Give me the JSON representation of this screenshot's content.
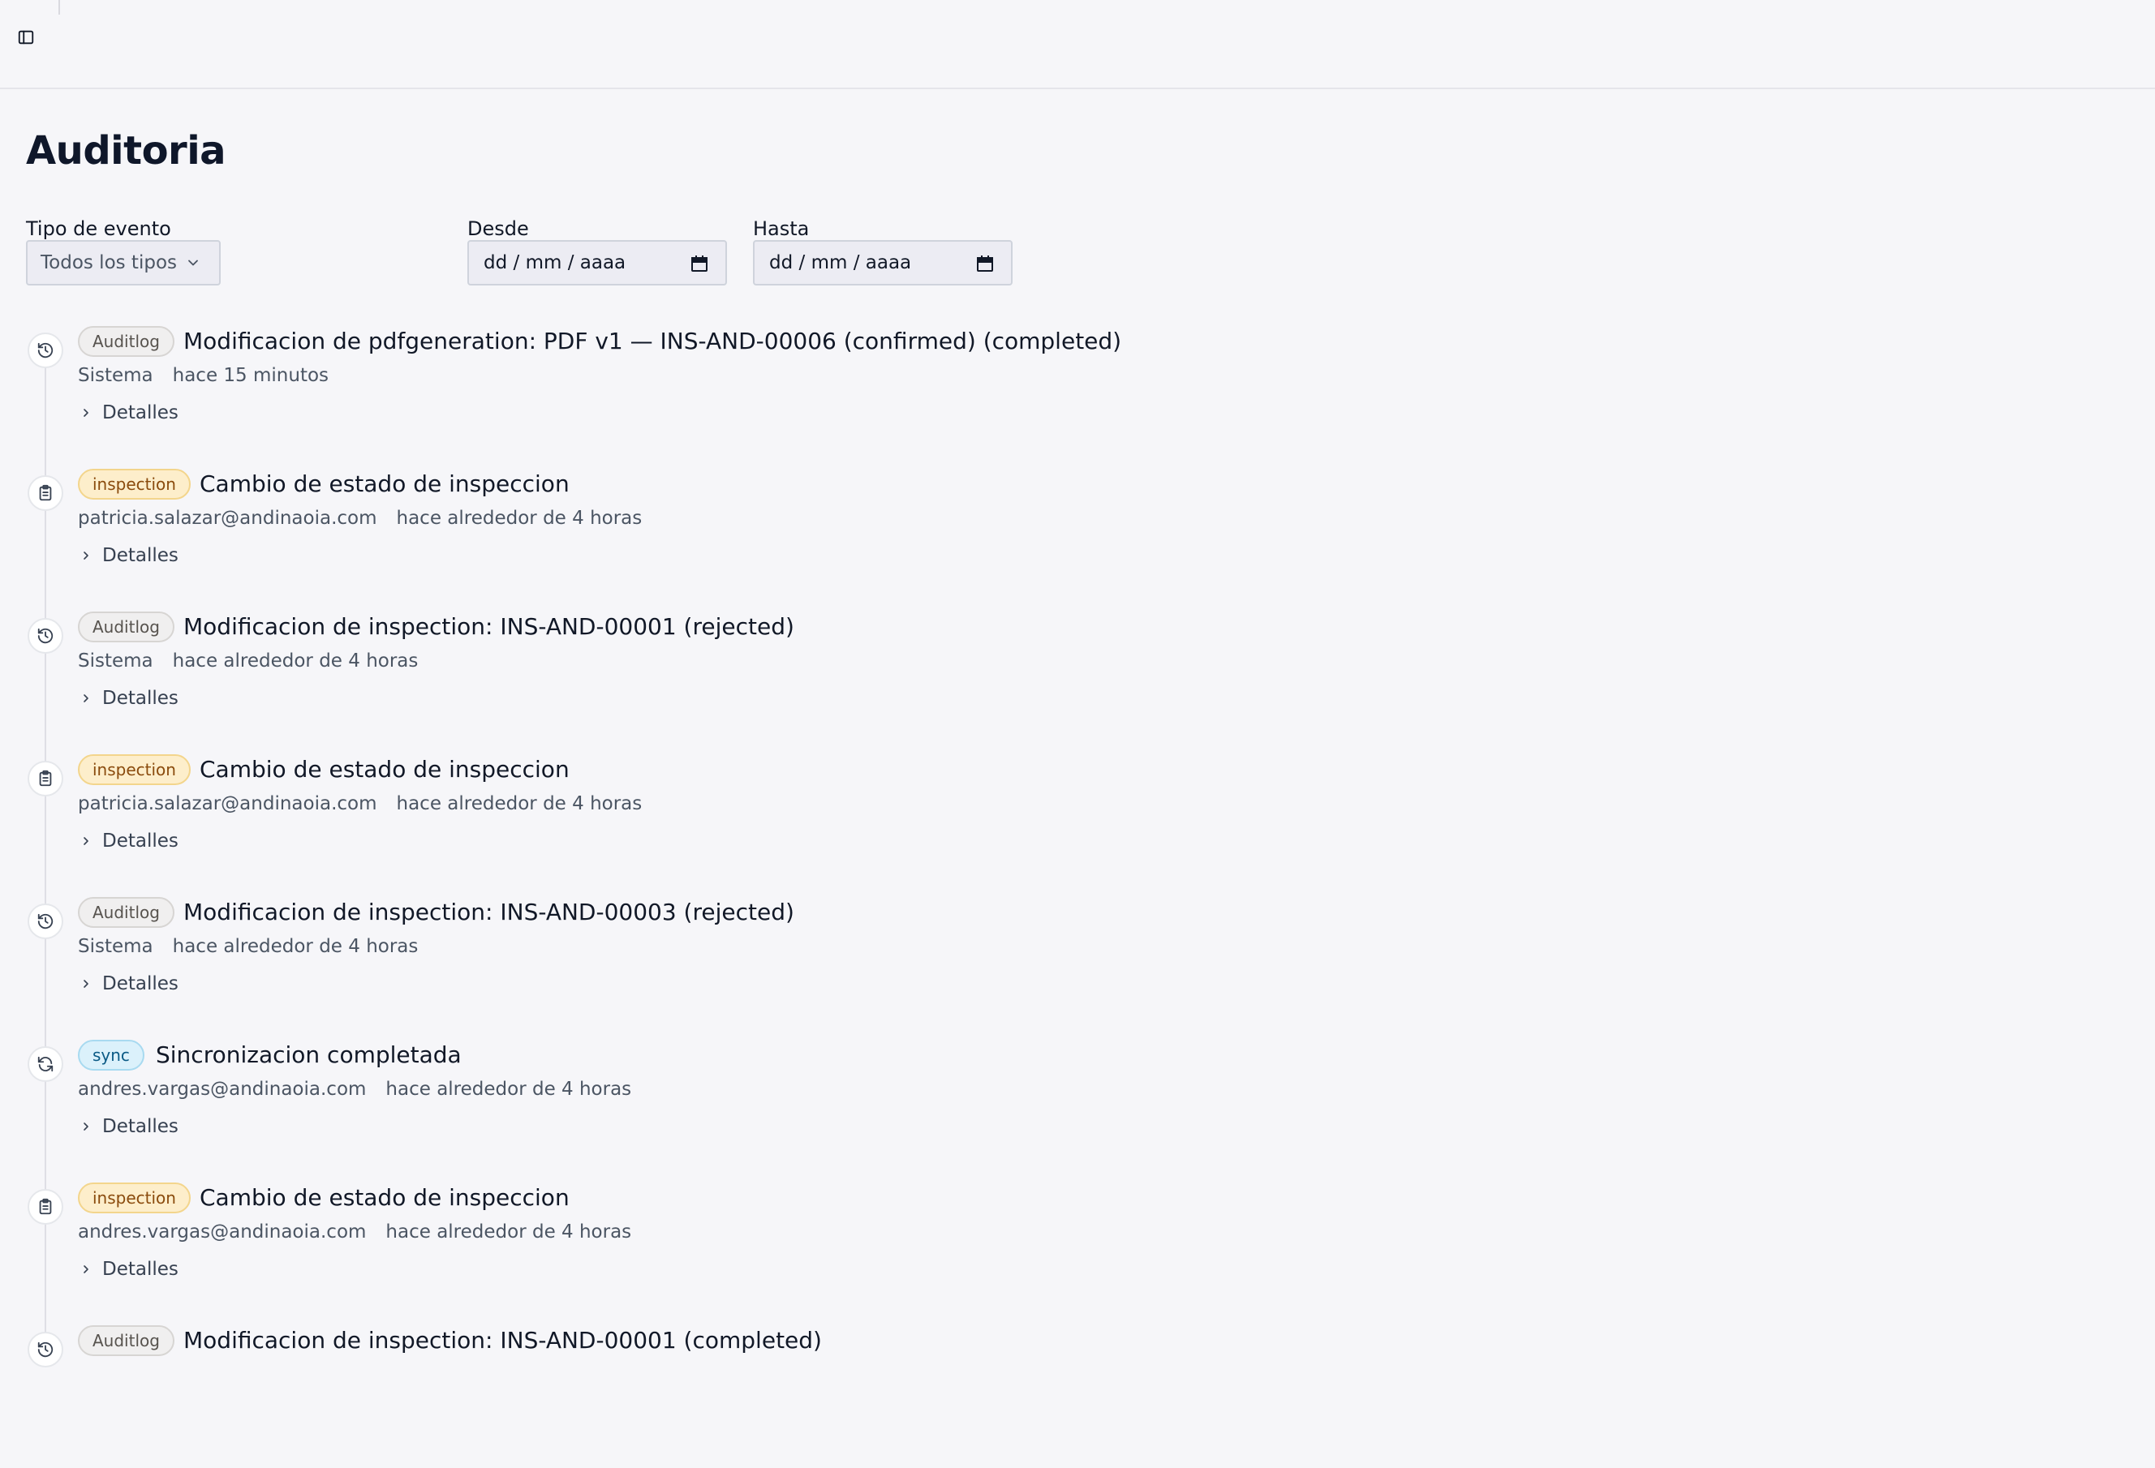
{
  "page": {
    "title": "Auditoria"
  },
  "filters": {
    "event_type_label": "Tipo de evento",
    "event_type_value": "Todos los tipos",
    "from_label": "Desde",
    "from_placeholder": "dd / mm / aaaa",
    "to_label": "Hasta",
    "to_placeholder": "dd / mm / aaaa"
  },
  "events": [
    {
      "badge": "Auditlog",
      "badge_kind": "auditlog",
      "icon": "history-icon",
      "title": "Modificacion de pdfgeneration: PDF v1 — INS-AND-00006 (confirmed) (completed)",
      "actor": "Sistema",
      "time": "hace 15 minutos",
      "details_label": "Detalles"
    },
    {
      "badge": "inspection",
      "badge_kind": "inspection",
      "icon": "clipboard-icon",
      "title": "Cambio de estado de inspeccion",
      "actor": "patricia.salazar@andinaoia.com",
      "time": "hace alrededor de 4 horas",
      "details_label": "Detalles"
    },
    {
      "badge": "Auditlog",
      "badge_kind": "auditlog",
      "icon": "history-icon",
      "title": "Modificacion de inspection: INS-AND-00001 (rejected)",
      "actor": "Sistema",
      "time": "hace alrededor de 4 horas",
      "details_label": "Detalles"
    },
    {
      "badge": "inspection",
      "badge_kind": "inspection",
      "icon": "clipboard-icon",
      "title": "Cambio de estado de inspeccion",
      "actor": "patricia.salazar@andinaoia.com",
      "time": "hace alrededor de 4 horas",
      "details_label": "Detalles"
    },
    {
      "badge": "Auditlog",
      "badge_kind": "auditlog",
      "icon": "history-icon",
      "title": "Modificacion de inspection: INS-AND-00003 (rejected)",
      "actor": "Sistema",
      "time": "hace alrededor de 4 horas",
      "details_label": "Detalles"
    },
    {
      "badge": "sync",
      "badge_kind": "sync",
      "icon": "refresh-icon",
      "title": "Sincronizacion completada",
      "actor": "andres.vargas@andinaoia.com",
      "time": "hace alrededor de 4 horas",
      "details_label": "Detalles"
    },
    {
      "badge": "inspection",
      "badge_kind": "inspection",
      "icon": "clipboard-icon",
      "title": "Cambio de estado de inspeccion",
      "actor": "andres.vargas@andinaoia.com",
      "time": "hace alrededor de 4 horas",
      "details_label": "Detalles"
    },
    {
      "badge": "Auditlog",
      "badge_kind": "auditlog",
      "icon": "history-icon",
      "title": "Modificacion de inspection: INS-AND-00001 (completed)",
      "actor": "",
      "time": "",
      "details_label": ""
    }
  ]
}
